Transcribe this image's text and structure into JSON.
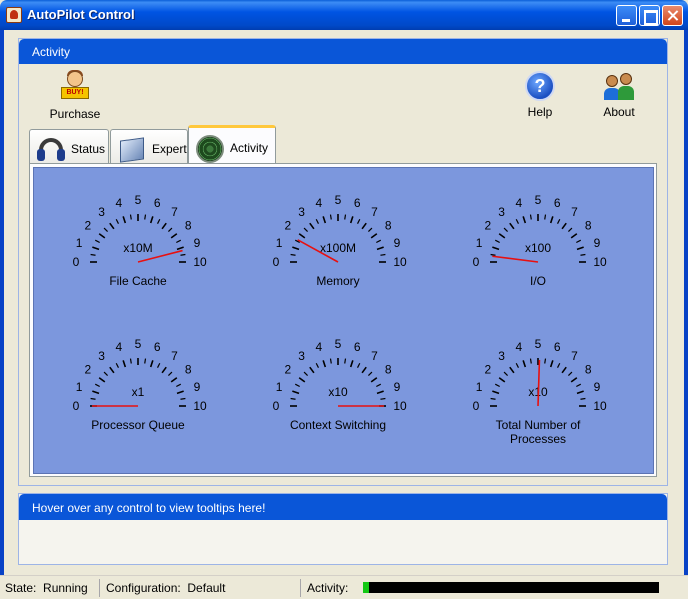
{
  "window": {
    "title": "AutoPilot Control"
  },
  "activity_panel": {
    "header": "Activity",
    "toolbar": {
      "purchase_label": "Purchase",
      "purchase_sign": "BUY!",
      "help_label": "Help",
      "help_glyph": "?",
      "about_label": "About"
    },
    "tabs": [
      {
        "label": "Status",
        "icon": "headset-icon"
      },
      {
        "label": "Expert",
        "icon": "expert-cube-icon"
      },
      {
        "label": "Activity",
        "icon": "radar-icon",
        "selected": true
      }
    ],
    "gauges": [
      {
        "label": "File Cache",
        "multiplier": "x10M",
        "value": 9.2
      },
      {
        "label": "Memory",
        "multiplier": "x100M",
        "value": 1.6
      },
      {
        "label": "I/O",
        "multiplier": "x100",
        "value": 0.4
      },
      {
        "label": "Processor Queue",
        "multiplier": "x1",
        "value": 0
      },
      {
        "label": "Context Switching",
        "multiplier": "x10",
        "value": 10
      },
      {
        "label": "Total Number of Processes",
        "label_lines": [
          "Total Number of",
          "Processes"
        ],
        "multiplier": "x10",
        "value": 5.1
      }
    ],
    "gauge_scale": [
      "0",
      "1",
      "2",
      "3",
      "4",
      "5",
      "6",
      "7",
      "8",
      "9",
      "10"
    ],
    "colors": {
      "gauge_background": "#7C97DD",
      "needle": "#E81010",
      "header": "#0A56D8"
    }
  },
  "tooltip_panel": {
    "header": "Hover over any control to view tooltips here!"
  },
  "statusbar": {
    "state_label": "State:",
    "state_value": "Running",
    "config_label": "Configuration:",
    "config_value": "Default",
    "activity_label": "Activity:",
    "activity_level": 0.02
  }
}
